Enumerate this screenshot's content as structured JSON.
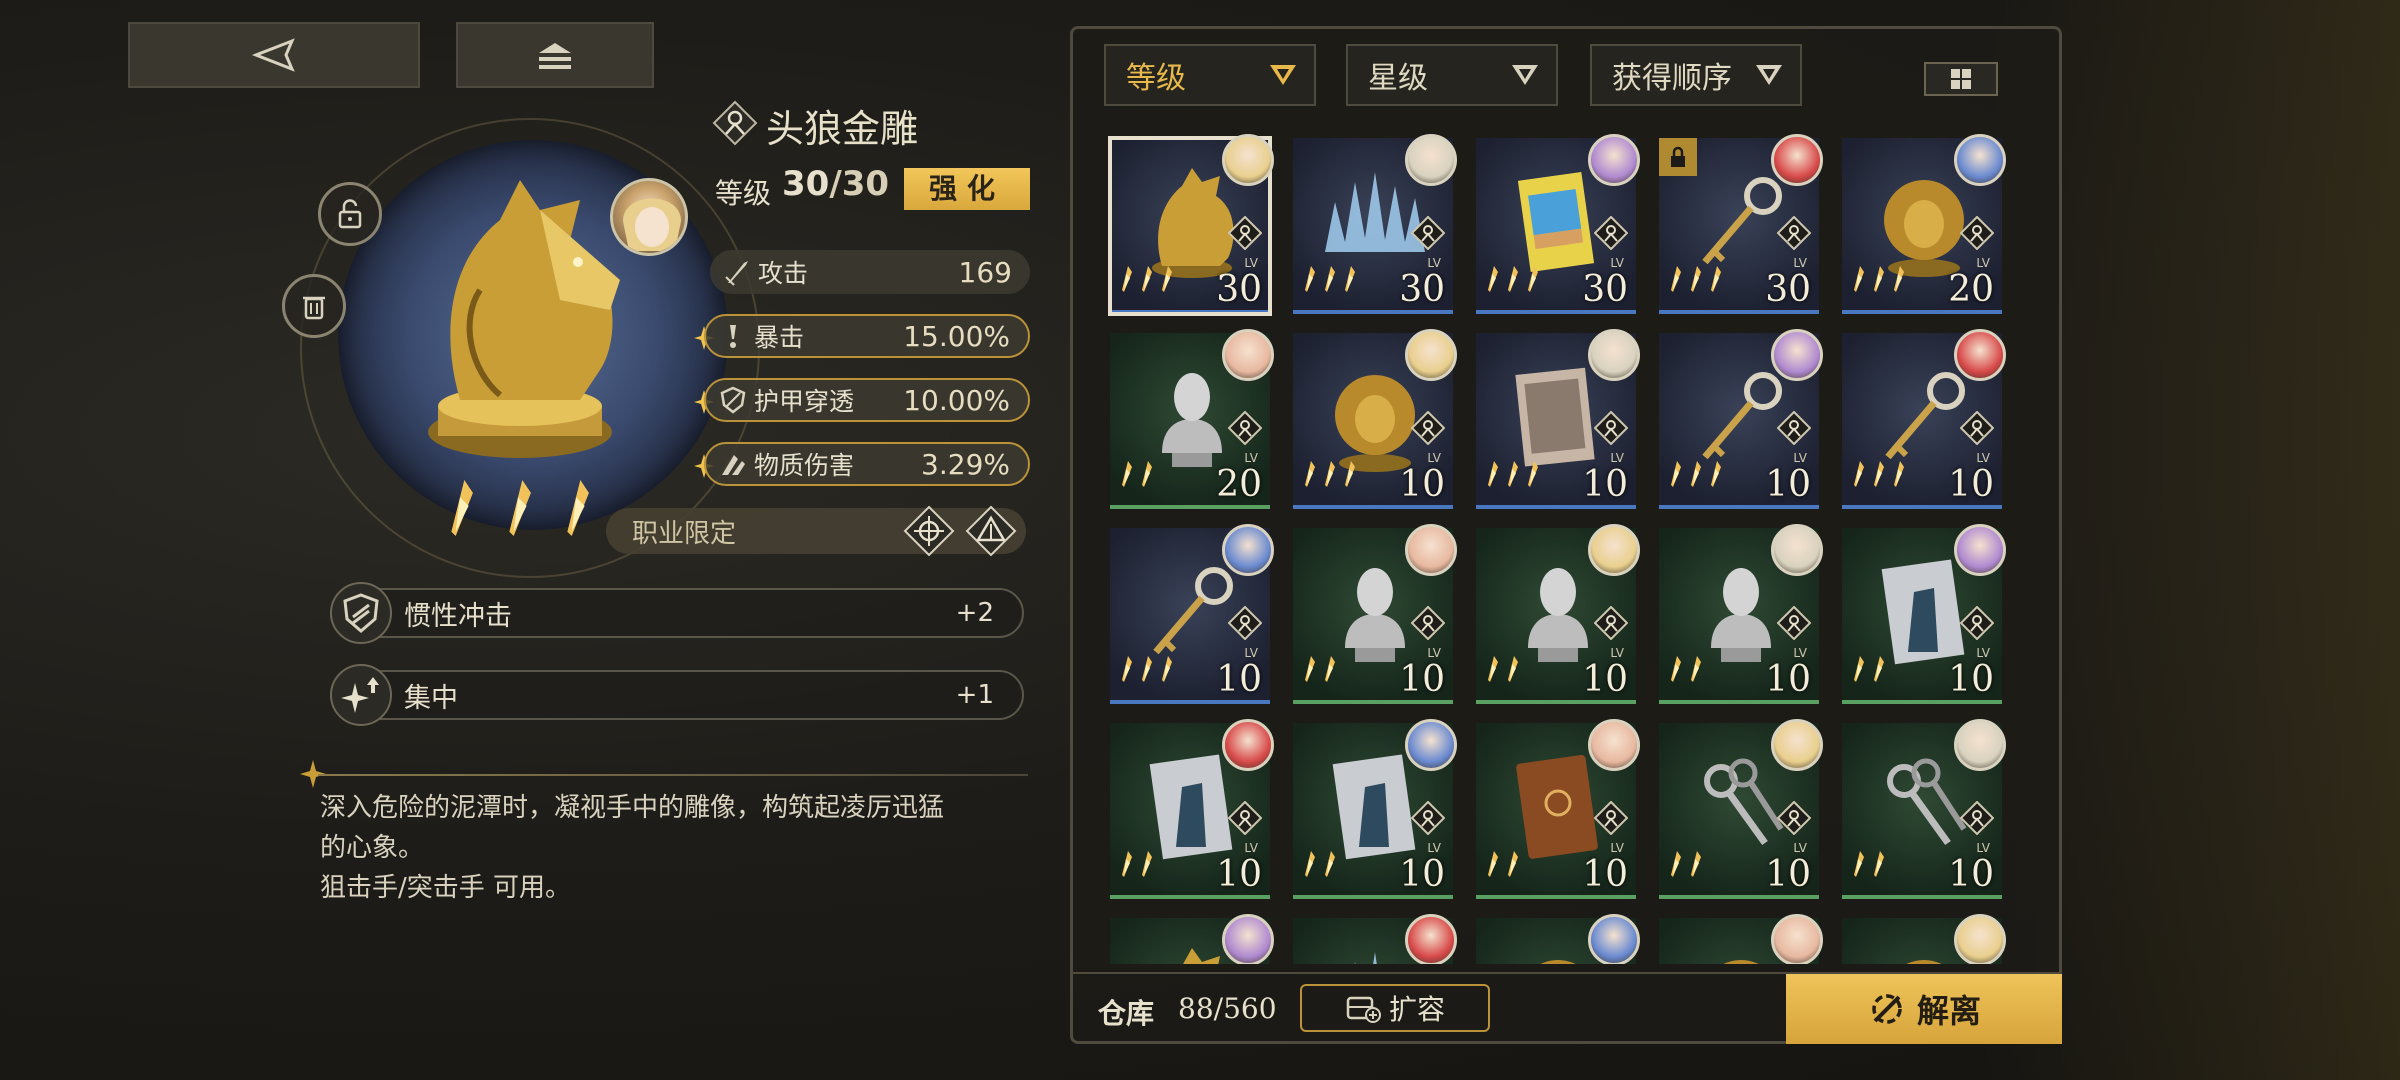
{
  "colors": {
    "gold": "#e8b84a",
    "panel": "#1c1b17",
    "rarity_blue": "#4a78c0",
    "rarity_green": "#5aa063"
  },
  "nav": {
    "back_icon": "back-arrow-icon",
    "home_icon": "home-icon"
  },
  "artifact": {
    "name": "头狼金雕",
    "level_label": "等级",
    "level_current": "30",
    "level_max": "/30",
    "enhance_label": "强化",
    "stars": 3,
    "base_stats": [
      {
        "label": "攻击",
        "value": "169"
      }
    ],
    "sub_stats": [
      {
        "label": "暴击",
        "value": "15.00%"
      },
      {
        "label": "护甲穿透",
        "value": "10.00%"
      },
      {
        "label": "物质伤害",
        "value": "3.29%"
      }
    ],
    "job_limit_label": "职业限定",
    "skills": [
      {
        "label": "惯性冲击",
        "value": "+2"
      },
      {
        "label": "集中",
        "value": "+1"
      }
    ],
    "description": "深入危险的泥潭时，凝视手中的雕像，构筑起凌厉迅猛\n的心象。\n狙击手/突击手 可用。"
  },
  "filters": [
    {
      "label": "等级"
    },
    {
      "label": "星级"
    },
    {
      "label": "获得顺序"
    }
  ],
  "inventory": {
    "items": [
      {
        "type": "wolf",
        "rarity": "blue",
        "level": "30",
        "stars": 3,
        "selected": true,
        "locked": false
      },
      {
        "type": "ice",
        "rarity": "blue",
        "level": "30",
        "stars": 3,
        "selected": false,
        "locked": false
      },
      {
        "type": "book",
        "rarity": "blue",
        "level": "30",
        "stars": 3,
        "selected": false,
        "locked": false
      },
      {
        "type": "key",
        "rarity": "blue",
        "level": "30",
        "stars": 3,
        "selected": false,
        "locked": true
      },
      {
        "type": "lion",
        "rarity": "blue",
        "level": "20",
        "stars": 3,
        "selected": false,
        "locked": false
      },
      {
        "type": "bust",
        "rarity": "green",
        "level": "20",
        "stars": 2,
        "selected": false,
        "locked": false
      },
      {
        "type": "lion",
        "rarity": "blue",
        "level": "10",
        "stars": 3,
        "selected": false,
        "locked": false
      },
      {
        "type": "photo",
        "rarity": "blue",
        "level": "10",
        "stars": 3,
        "selected": false,
        "locked": false
      },
      {
        "type": "key",
        "rarity": "blue",
        "level": "10",
        "stars": 3,
        "selected": false,
        "locked": false
      },
      {
        "type": "key",
        "rarity": "blue",
        "level": "10",
        "stars": 3,
        "selected": false,
        "locked": false
      },
      {
        "type": "key",
        "rarity": "blue",
        "level": "10",
        "stars": 3,
        "selected": false,
        "locked": false
      },
      {
        "type": "bust",
        "rarity": "green",
        "level": "10",
        "stars": 2,
        "selected": false,
        "locked": false
      },
      {
        "type": "bust",
        "rarity": "green",
        "level": "10",
        "stars": 2,
        "selected": false,
        "locked": false
      },
      {
        "type": "bust",
        "rarity": "green",
        "level": "10",
        "stars": 2,
        "selected": false,
        "locked": false
      },
      {
        "type": "card",
        "rarity": "green",
        "level": "10",
        "stars": 2,
        "selected": false,
        "locked": false
      },
      {
        "type": "card",
        "rarity": "green",
        "level": "10",
        "stars": 2,
        "selected": false,
        "locked": false
      },
      {
        "type": "card",
        "rarity": "green",
        "level": "10",
        "stars": 2,
        "selected": false,
        "locked": false
      },
      {
        "type": "tome",
        "rarity": "green",
        "level": "10",
        "stars": 2,
        "selected": false,
        "locked": false
      },
      {
        "type": "keys",
        "rarity": "green",
        "level": "10",
        "stars": 2,
        "selected": false,
        "locked": false
      },
      {
        "type": "keys",
        "rarity": "green",
        "level": "10",
        "stars": 2,
        "selected": false,
        "locked": false
      },
      {
        "type": "wolf",
        "rarity": "green",
        "level": "",
        "stars": 0,
        "selected": false,
        "locked": false
      },
      {
        "type": "ice",
        "rarity": "green",
        "level": "",
        "stars": 0,
        "selected": false,
        "locked": false
      },
      {
        "type": "lion",
        "rarity": "green",
        "level": "",
        "stars": 0,
        "selected": false,
        "locked": false
      },
      {
        "type": "lion",
        "rarity": "green",
        "level": "",
        "stars": 0,
        "selected": false,
        "locked": false
      },
      {
        "type": "lion",
        "rarity": "green",
        "level": "",
        "stars": 0,
        "selected": false,
        "locked": false
      }
    ],
    "lv_tag": "LV"
  },
  "footer": {
    "warehouse_label": "仓库",
    "warehouse_count": "88/560",
    "expand_label": "扩容",
    "dismantle_label": "解离"
  }
}
